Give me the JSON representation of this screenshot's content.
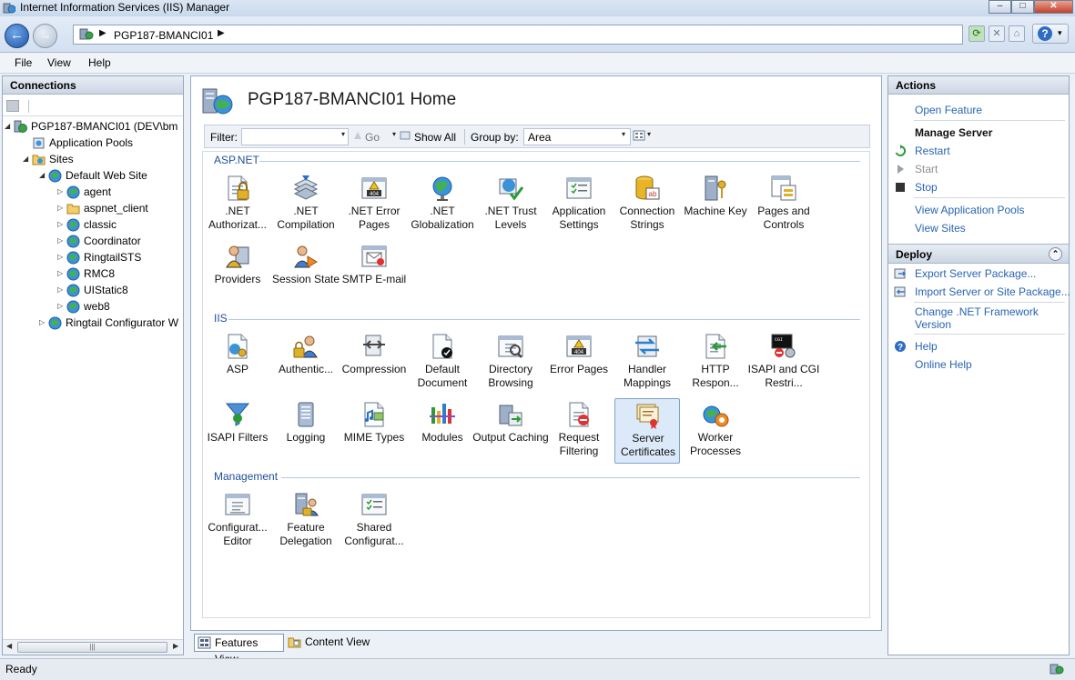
{
  "window": {
    "title": "Internet Information Services (IIS) Manager",
    "minimize": "–",
    "maximize": "□",
    "close": "✕"
  },
  "nav": {
    "back": "←",
    "forward": "→",
    "breadcrumb": "PGP187-BMANCI01",
    "help": "?",
    "help_dropdown": "▾"
  },
  "menu": {
    "file": "File",
    "view": "View",
    "help": "Help"
  },
  "connections": {
    "title": "Connections",
    "tree": [
      {
        "label": "PGP187-BMANCI01 (DEV\\bm",
        "toggle": "◢",
        "icon": "server-icon"
      },
      {
        "label": "Application Pools",
        "toggle": "",
        "icon": "app-pools-icon"
      },
      {
        "label": "Sites",
        "toggle": "◢",
        "icon": "sites-icon"
      },
      {
        "label": "Default Web Site",
        "toggle": "◢",
        "icon": "globe-icon"
      },
      {
        "label": "agent",
        "toggle": "▷",
        "icon": "globe-icon"
      },
      {
        "label": "aspnet_client",
        "toggle": "▷",
        "icon": "folder-icon"
      },
      {
        "label": "classic",
        "toggle": "▷",
        "icon": "globe-icon"
      },
      {
        "label": "Coordinator",
        "toggle": "▷",
        "icon": "globe-icon"
      },
      {
        "label": "RingtailSTS",
        "toggle": "▷",
        "icon": "globe-icon"
      },
      {
        "label": "RMC8",
        "toggle": "▷",
        "icon": "globe-icon"
      },
      {
        "label": "UIStatic8",
        "toggle": "▷",
        "icon": "globe-icon"
      },
      {
        "label": "web8",
        "toggle": "▷",
        "icon": "globe-icon"
      },
      {
        "label": "Ringtail Configurator W",
        "toggle": "▷",
        "icon": "globe-icon"
      }
    ],
    "scroll_left": "◀",
    "scroll_right": "▶",
    "scroll_grip": "|||"
  },
  "home": {
    "title": "PGP187-BMANCI01 Home",
    "filter_label": "Filter:",
    "go_label": "Go",
    "show_all_label": "Show All",
    "group_by_label": "Group by:",
    "group_by_value": "Area",
    "dropdown_arrow": "▾"
  },
  "groups": [
    {
      "title": "ASP.NET",
      "items": [
        {
          "label": ".NET Authorizat...",
          "icon": "net-authorization-icon"
        },
        {
          "label": ".NET Compilation",
          "icon": "net-compilation-icon"
        },
        {
          "label": ".NET Error Pages",
          "icon": "net-error-pages-icon"
        },
        {
          "label": ".NET Globalization",
          "icon": "net-globalization-icon"
        },
        {
          "label": ".NET Trust Levels",
          "icon": "net-trust-levels-icon"
        },
        {
          "label": "Application Settings",
          "icon": "application-settings-icon"
        },
        {
          "label": "Connection Strings",
          "icon": "connection-strings-icon"
        },
        {
          "label": "Machine Key",
          "icon": "machine-key-icon"
        },
        {
          "label": "Pages and Controls",
          "icon": "pages-controls-icon"
        },
        {
          "label": "Providers",
          "icon": "providers-icon"
        },
        {
          "label": "Session State",
          "icon": "session-state-icon"
        },
        {
          "label": "SMTP E-mail",
          "icon": "smtp-email-icon"
        }
      ]
    },
    {
      "title": "IIS",
      "items": [
        {
          "label": "ASP",
          "icon": "asp-icon"
        },
        {
          "label": "Authentic...",
          "icon": "authentication-icon"
        },
        {
          "label": "Compression",
          "icon": "compression-icon"
        },
        {
          "label": "Default Document",
          "icon": "default-document-icon"
        },
        {
          "label": "Directory Browsing",
          "icon": "directory-browsing-icon"
        },
        {
          "label": "Error Pages",
          "icon": "error-pages-icon"
        },
        {
          "label": "Handler Mappings",
          "icon": "handler-mappings-icon"
        },
        {
          "label": "HTTP Respon...",
          "icon": "http-response-icon"
        },
        {
          "label": "ISAPI and CGI Restri...",
          "icon": "isapi-cgi-icon"
        },
        {
          "label": "ISAPI Filters",
          "icon": "isapi-filters-icon"
        },
        {
          "label": "Logging",
          "icon": "logging-icon"
        },
        {
          "label": "MIME Types",
          "icon": "mime-types-icon"
        },
        {
          "label": "Modules",
          "icon": "modules-icon"
        },
        {
          "label": "Output Caching",
          "icon": "output-caching-icon"
        },
        {
          "label": "Request Filtering",
          "icon": "request-filtering-icon"
        },
        {
          "label": "Server Certificates",
          "icon": "server-certificates-icon",
          "selected": true
        },
        {
          "label": "Worker Processes",
          "icon": "worker-processes-icon"
        }
      ]
    },
    {
      "title": "Management",
      "items": [
        {
          "label": "Configurat... Editor",
          "icon": "configuration-editor-icon"
        },
        {
          "label": "Feature Delegation",
          "icon": "feature-delegation-icon"
        },
        {
          "label": "Shared Configurat...",
          "icon": "shared-configuration-icon"
        }
      ]
    }
  ],
  "views": {
    "features": "Features View",
    "content": "Content View"
  },
  "actions": {
    "title": "Actions",
    "open_feature": "Open Feature",
    "manage_server": "Manage Server",
    "restart": "Restart",
    "start": "Start",
    "stop": "Stop",
    "view_app_pools": "View Application Pools",
    "view_sites": "View Sites",
    "deploy": "Deploy",
    "collapse": "⌃",
    "export_package": "Export Server Package...",
    "import_package": "Import Server or Site Package...",
    "change_net_line1": "Change .NET Framework",
    "change_net_line2": "Version",
    "help": "Help",
    "online_help": "Online Help"
  },
  "status": {
    "text": "Ready"
  }
}
